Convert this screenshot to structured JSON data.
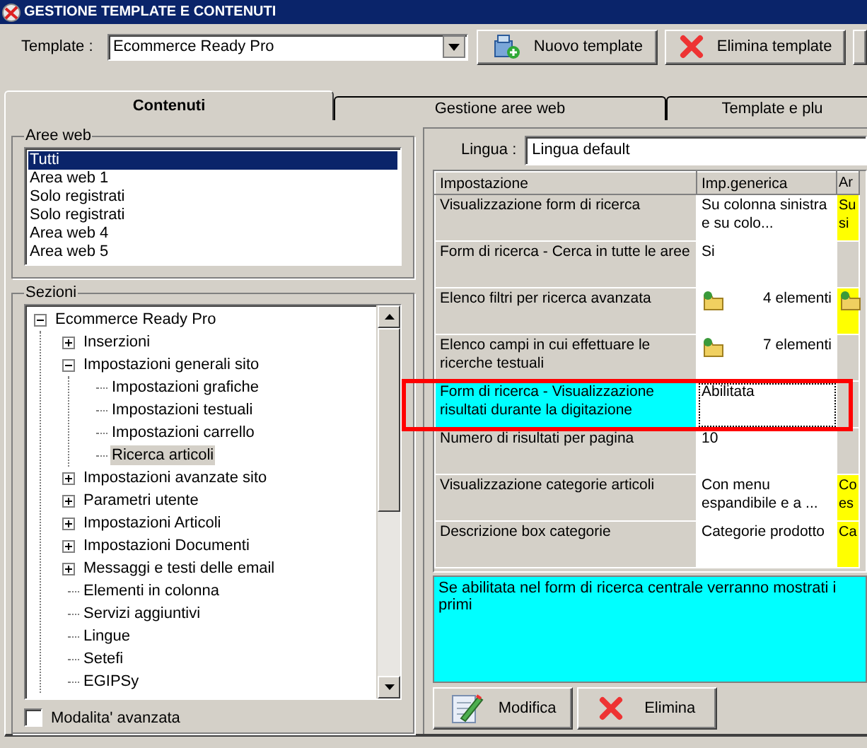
{
  "window": {
    "title": "GESTIONE TEMPLATE E CONTENUTI"
  },
  "toolbar": {
    "template_label": "Template :",
    "template_value": "Ecommerce Ready Pro",
    "buttons": [
      {
        "label": "Nuovo template",
        "kind": "new"
      },
      {
        "label": "Elimina template",
        "kind": "delete"
      }
    ]
  },
  "tabs": [
    {
      "label": "Contenuti",
      "selected": true
    },
    {
      "label": "Gestione aree web",
      "selected": false
    },
    {
      "label": "Template e plu",
      "selected": false
    }
  ],
  "aree_web": {
    "title": "Aree web",
    "items": [
      {
        "label": "Tutti",
        "selected": true
      },
      {
        "label": "Area web 1",
        "selected": false
      },
      {
        "label": "Solo registrati",
        "selected": false
      },
      {
        "label": "Solo registrati",
        "selected": false
      },
      {
        "label": "Area web 4",
        "selected": false
      },
      {
        "label": "Area web 5",
        "selected": false
      }
    ]
  },
  "sezioni": {
    "title": "Sezioni",
    "tree": [
      {
        "label": "Ecommerce Ready Pro",
        "expanded": true,
        "selected": false,
        "children": [
          {
            "label": "Inserzioni",
            "expanded": false,
            "selected": false
          },
          {
            "label": "Impostazioni generali sito",
            "expanded": true,
            "selected": false,
            "children": [
              {
                "label": "Impostazioni grafiche",
                "selected": false
              },
              {
                "label": "Impostazioni testuali",
                "selected": false
              },
              {
                "label": "Impostazioni carrello",
                "selected": false
              },
              {
                "label": "Ricerca articoli",
                "selected": true
              }
            ]
          },
          {
            "label": "Impostazioni avanzate sito",
            "expanded": false,
            "selected": false
          },
          {
            "label": "Parametri utente",
            "expanded": false,
            "selected": false
          },
          {
            "label": "Impostazioni Articoli",
            "expanded": false,
            "selected": false
          },
          {
            "label": "Impostazioni Documenti",
            "expanded": false,
            "selected": false
          },
          {
            "label": "Messaggi e testi delle email",
            "expanded": false,
            "selected": false
          },
          {
            "label": "Elementi in colonna",
            "selected": false
          },
          {
            "label": "Servizi aggiuntivi",
            "selected": false
          },
          {
            "label": "Lingue",
            "selected": false
          },
          {
            "label": "Setefi",
            "selected": false
          },
          {
            "label": "EGIPSy",
            "selected": false
          }
        ]
      }
    ]
  },
  "advanced_mode": {
    "label": "Modalita' avanzata",
    "checked": false
  },
  "lingua": {
    "label": "Lingua :",
    "value": "Lingua default"
  },
  "table": {
    "columns": [
      "Impostazione",
      "Imp.generica",
      "Ar"
    ],
    "rows": [
      {
        "setting": "Visualizzazione form di ricerca",
        "value": "Su colonna sinistra e su colo...",
        "value_icon": false,
        "column_3": "Su si",
        "column_3_icon": false,
        "column_3_highlighted": true,
        "selected": false
      },
      {
        "setting": "Form di ricerca - Cerca in tutte le aree",
        "value": "Si",
        "value_icon": false,
        "column_3_icon": false,
        "column_3_highlighted": false,
        "selected": false
      },
      {
        "setting": "Elenco filtri per ricerca avanzata",
        "value": "4 elementi",
        "value_icon": true,
        "column_3_icon": true,
        "column_3_highlighted": true,
        "selected": false
      },
      {
        "setting": "Elenco campi in cui effettuare le ricerche testuali",
        "value": "7 elementi",
        "value_icon": true,
        "column_3_icon": false,
        "column_3_highlighted": false,
        "selected": false
      },
      {
        "setting": "Form di ricerca - Visualizzazione risultati durante la digitazione",
        "value": "Abilitata",
        "value_icon": false,
        "column_3_icon": false,
        "column_3_highlighted": false,
        "selected": true
      },
      {
        "setting": "Numero di risultati per pagina",
        "value": "10",
        "value_icon": false,
        "column_3_icon": false,
        "column_3_highlighted": false,
        "selected": false
      },
      {
        "setting": "Visualizzazione categorie articoli",
        "value": "Con menu espandibile e a ...",
        "value_icon": false,
        "column_3": "Co es",
        "column_3_icon": false,
        "column_3_highlighted": true,
        "selected": false
      },
      {
        "setting": "Descrizione box categorie",
        "value": "Categorie prodotto",
        "value_icon": false,
        "column_3": "Ca",
        "column_3_icon": false,
        "column_3_highlighted": true,
        "selected": false
      }
    ]
  },
  "description": "Se abilitata nel form di ricerca centrale verranno mostrati i primi",
  "actions": [
    {
      "label": "Modifica",
      "kind": "edit"
    },
    {
      "label": "Elimina",
      "kind": "delete"
    }
  ]
}
